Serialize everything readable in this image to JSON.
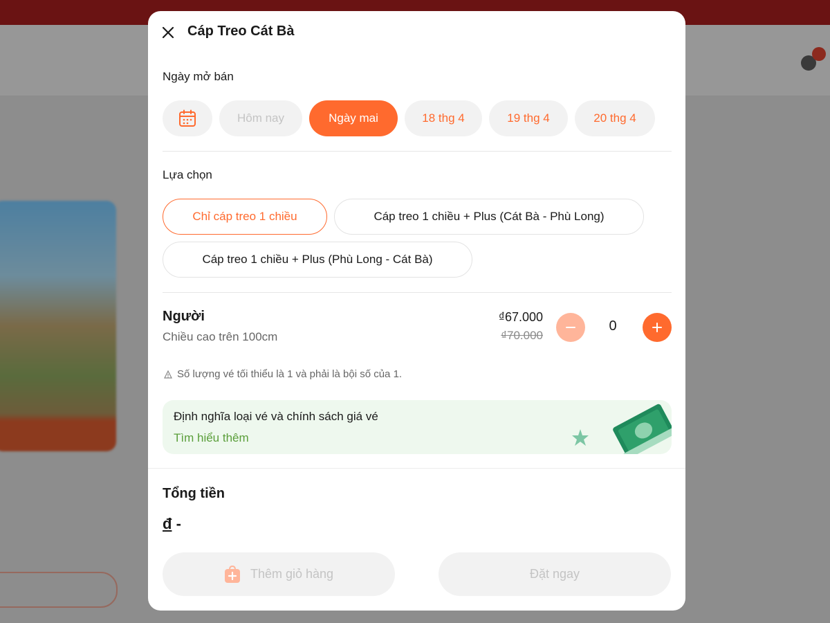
{
  "modal": {
    "title": "Cáp Treo Cát Bà",
    "date_section_label": "Ngày mở bán",
    "dates": [
      {
        "label": "Hôm nay",
        "state": "disabled"
      },
      {
        "label": "Ngày mai",
        "state": "selected"
      },
      {
        "label": "18 thg 4",
        "state": "available"
      },
      {
        "label": "19 thg 4",
        "state": "available"
      },
      {
        "label": "20 thg 4",
        "state": "available"
      }
    ],
    "option_section_label": "Lựa chọn",
    "options": [
      {
        "label": "Chỉ cáp treo 1 chiều",
        "selected": true
      },
      {
        "label": "Cáp treo 1 chiều + Plus (Cát Bà - Phù Long)",
        "selected": false
      },
      {
        "label": "Cáp treo 1 chiều + Plus (Phù Long - Cát Bà)",
        "selected": false
      }
    ],
    "ticket": {
      "name": "Người",
      "description": "Chiều cao trên 100cm",
      "price": "₫67.000",
      "original_price": "₫70.000",
      "quantity": "0"
    },
    "note": "Số lượng vé tối thiểu là 1 và phải là bội số của 1.",
    "info_banner": {
      "title": "Định nghĩa loại vé và chính sách giá vé",
      "link": "Tìm hiểu thêm"
    },
    "total": {
      "label": "Tổng tiền",
      "currency": "đ",
      "value": "-"
    },
    "buttons": {
      "add_to_cart": "Thêm giỏ hàng",
      "book_now": "Đặt ngay"
    }
  },
  "colors": {
    "accent": "#ff6a2e",
    "accent_light": "#ffb59a",
    "link_green": "#5a9e3a",
    "banner_bg": "#eef8ee",
    "disabled_text": "#c4c4c4"
  },
  "icons": [
    "close-icon",
    "calendar-icon",
    "minus-icon",
    "plus-icon",
    "info-icon",
    "ticket-illustration",
    "cart-add-icon"
  ]
}
